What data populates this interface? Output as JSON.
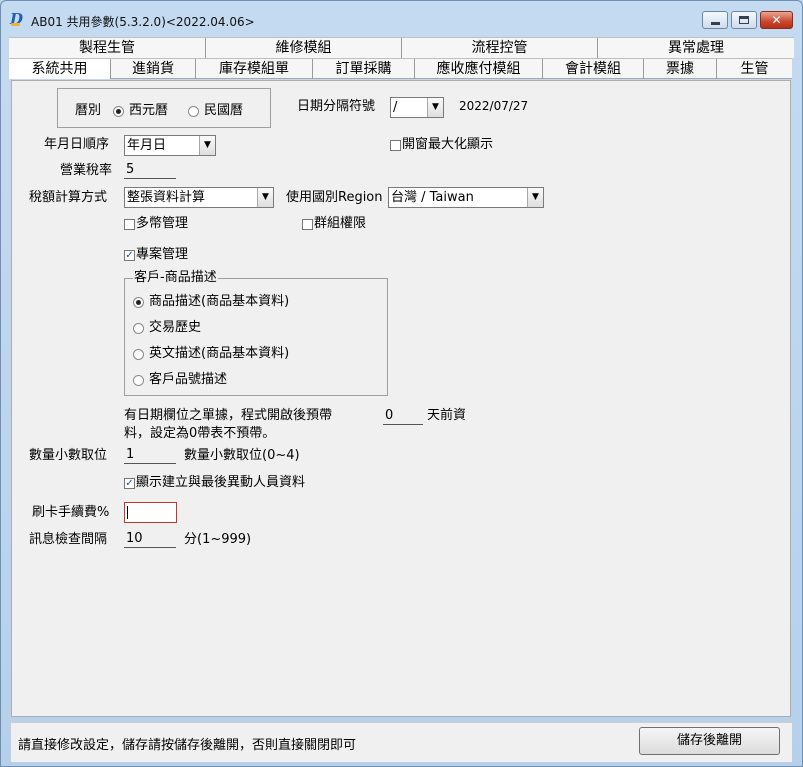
{
  "window": {
    "title": "AB01 共用參數(5.3.2.0)<2022.04.06>",
    "close_symbol": "✕"
  },
  "tabs_row1": [
    "製程生管",
    "維修模組",
    "流程控管",
    "異常處理"
  ],
  "tabs_row2": [
    "系統共用",
    "進銷貨",
    "庫存模組單",
    "訂單採購",
    "應收應付模組",
    "會計模組",
    "票據",
    "生管"
  ],
  "form": {
    "calendar": {
      "label": "曆別",
      "options": [
        "西元曆",
        "民國曆"
      ],
      "selected": "西元曆"
    },
    "date_separator": {
      "label": "日期分隔符號",
      "value": "/",
      "sample": "2022/07/27"
    },
    "date_order": {
      "label": "年月日順序",
      "value": "年月日"
    },
    "maximize": {
      "label": "開窗最大化顯示",
      "checked": false
    },
    "tax_rate": {
      "label": "營業稅率",
      "value": "5"
    },
    "tax_method": {
      "label": "稅額計算方式",
      "value": "整張資料計算"
    },
    "region": {
      "label": "使用國別Region",
      "value": "台灣  / Taiwan"
    },
    "multi_currency": {
      "label": "多幣管理",
      "checked": false
    },
    "group_permission": {
      "label": "群組權限",
      "checked": false
    },
    "project_mgmt": {
      "label": "專案管理",
      "checked": true
    },
    "customer_desc": {
      "legend": "客戶-商品描述",
      "options": [
        "商品描述(商品基本資料)",
        "交易歷史",
        "英文描述(商品基本資料)",
        "客戶品號描述"
      ],
      "selected": "商品描述(商品基本資料)"
    },
    "date_fill": {
      "prefix": "有日期欄位之單據，程式開啟後預帶",
      "value": "0",
      "suffix": "天前資",
      "line2": "料，設定為0帶表不預帶。"
    },
    "qty_decimal": {
      "label": "數量小數取位",
      "value": "1",
      "hint": "數量小數取位(0~4)"
    },
    "show_users": {
      "label": "顯示建立與最後異動人員資料",
      "checked": true
    },
    "card_fee": {
      "label": "刷卡手續費%",
      "value": ""
    },
    "msg_interval": {
      "label": "訊息檢查間隔",
      "value": "10",
      "hint": "分(1~999)"
    }
  },
  "status": {
    "message": "請直接修改設定，儲存請按儲存後離開，否則直接關閉即可",
    "save_button": "儲存後離開"
  },
  "colors": {
    "accent": "#1f5fb8",
    "focus_border": "#c0392b",
    "window_frame": "#bcd6ee"
  }
}
